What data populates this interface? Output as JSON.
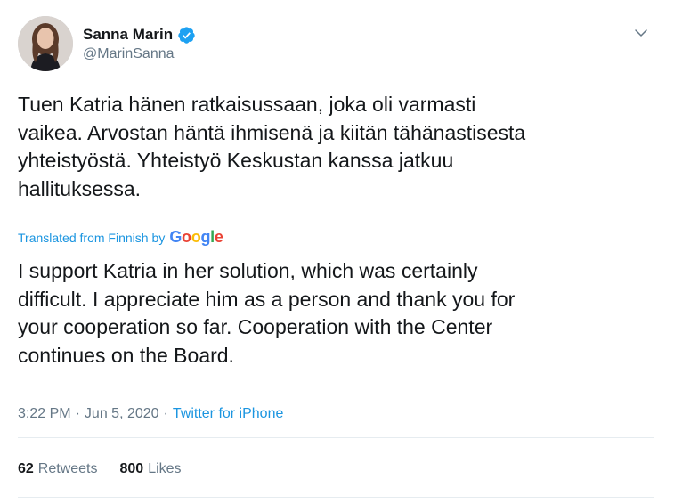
{
  "author": {
    "name": "Sanna Marin",
    "handle": "@MarinSanna",
    "verified": true
  },
  "tweet": {
    "original_text": "Tuen Katria hänen ratkaisussaan, joka oli varmasti\nvaikea. Arvostan häntä ihmisenä ja kiitän tähänastisesta\nyhteistyöstä. Yhteistyö Keskustan kanssa jatkuu\nhallituksessa.",
    "translation_label": "Translated from Finnish",
    "translation_by": "by",
    "translation_provider": "Google",
    "translated_text": "I support Katria in her solution, which was certainly\ndifficult. I appreciate him as a person and thank you for\nyour cooperation so far. Cooperation with the Center\ncontinues on the Board."
  },
  "meta": {
    "time": "3:22 PM",
    "separator": "·",
    "date": "Jun 5, 2020",
    "source": "Twitter for iPhone"
  },
  "stats": {
    "retweets_count": "62",
    "retweets_label": "Retweets",
    "likes_count": "800",
    "likes_label": "Likes"
  },
  "icons": {
    "verified": "verified-badge-icon",
    "menu": "chevron-down-icon"
  },
  "colors": {
    "text": "#14171a",
    "secondary": "#657786",
    "link": "#1b95e0",
    "verified": "#1da1f2",
    "divider": "#e6ecf0",
    "google_blue": "#4285F4",
    "google_red": "#EA4335",
    "google_yellow": "#FBBC05",
    "google_green": "#34A853"
  }
}
